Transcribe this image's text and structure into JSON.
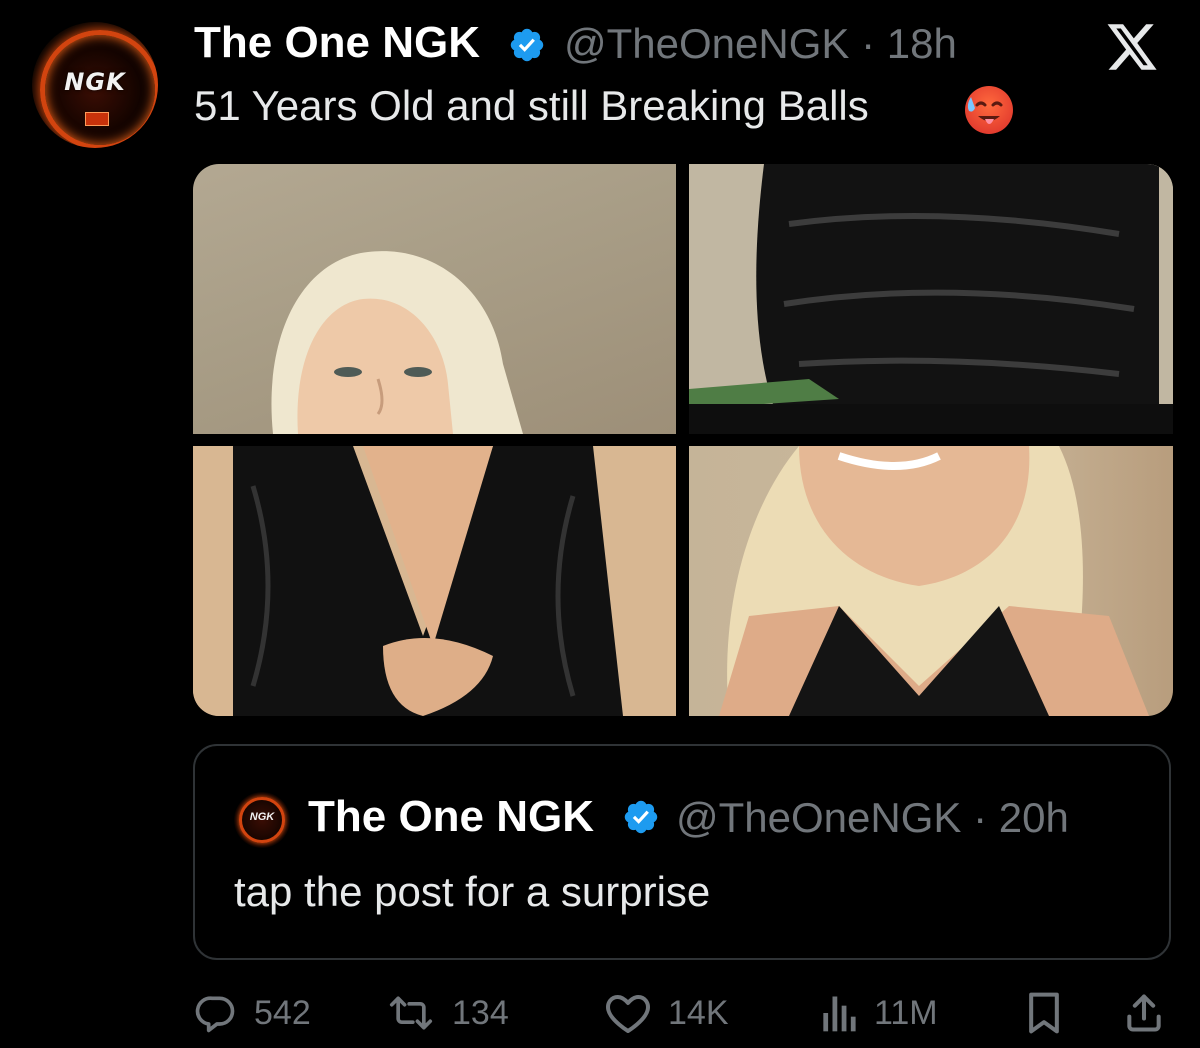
{
  "post": {
    "author_name": "The One NGK",
    "handle": "@TheOneNGK",
    "time": "18h",
    "text": "51 Years Old and still Breaking Balls",
    "emoji": "hot-face-emoji",
    "avatar_text": "NGK"
  },
  "media": {
    "images": [
      {
        "description": "photo-1"
      },
      {
        "description": "photo-2"
      },
      {
        "description": "photo-3"
      },
      {
        "description": "photo-4"
      }
    ]
  },
  "quoted_post": {
    "author_name": "The One NGK",
    "handle": "@TheOneNGK",
    "time": "20h",
    "text": "tap the post for a surprise",
    "avatar_text": "NGK"
  },
  "actions": {
    "replies": "542",
    "reposts": "134",
    "likes": "14K",
    "views": "11M"
  },
  "colors": {
    "background": "#000000",
    "text_primary": "#e7e9ea",
    "text_secondary": "#71767b",
    "verified": "#1d9bf0",
    "border": "#2f3336"
  },
  "icons": {
    "platform": "x-logo-icon",
    "verified": "verified-badge-icon",
    "reply": "reply-icon",
    "repost": "repost-icon",
    "like": "heart-icon",
    "views": "views-icon",
    "bookmark": "bookmark-icon",
    "share": "share-icon"
  }
}
